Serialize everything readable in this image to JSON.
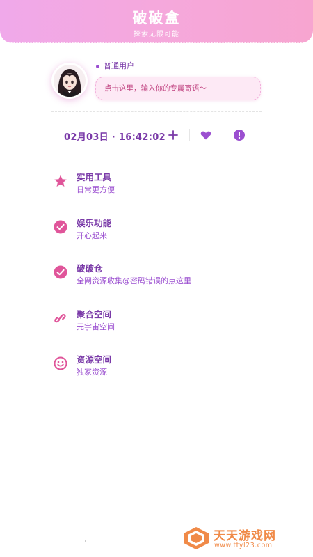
{
  "header": {
    "title": "破破盒",
    "subtitle": "探索无限可能",
    "gradient": [
      "#f0a9ea",
      "#f7a5d0"
    ]
  },
  "profile": {
    "avatar_icon": "avatar-anime-girl",
    "user_type": "普通用户",
    "signature_placeholder": "点击这里，输入你的专属寄语～"
  },
  "statusbar": {
    "datetime": "02月03日 · 16:42:02",
    "icons": [
      "plus-icon",
      "heart-icon",
      "alert-icon"
    ]
  },
  "menu": {
    "items": [
      {
        "title": "实用工具",
        "subtitle": "日常更方便",
        "icon": "star-icon"
      },
      {
        "title": "娱乐功能",
        "subtitle": "开心起来",
        "icon": "check-circle-icon"
      },
      {
        "title": "破破仓",
        "subtitle": "全网资源收集@密码错误的点这里",
        "icon": "check-circle-icon"
      },
      {
        "title": "聚合空间",
        "subtitle": "元宇宙空间",
        "icon": "link-icon"
      },
      {
        "title": "资源空间",
        "subtitle": "独家资源",
        "icon": "smile-icon"
      }
    ]
  },
  "watermark": {
    "text": "天天游戏网",
    "url": "www.ttyl23.com"
  },
  "colors": {
    "accent_purple": "#7a3aa8",
    "accent_pink": "#e0559a",
    "signature_bg": "#fde9f5",
    "watermark_orange": "#f08a48"
  }
}
